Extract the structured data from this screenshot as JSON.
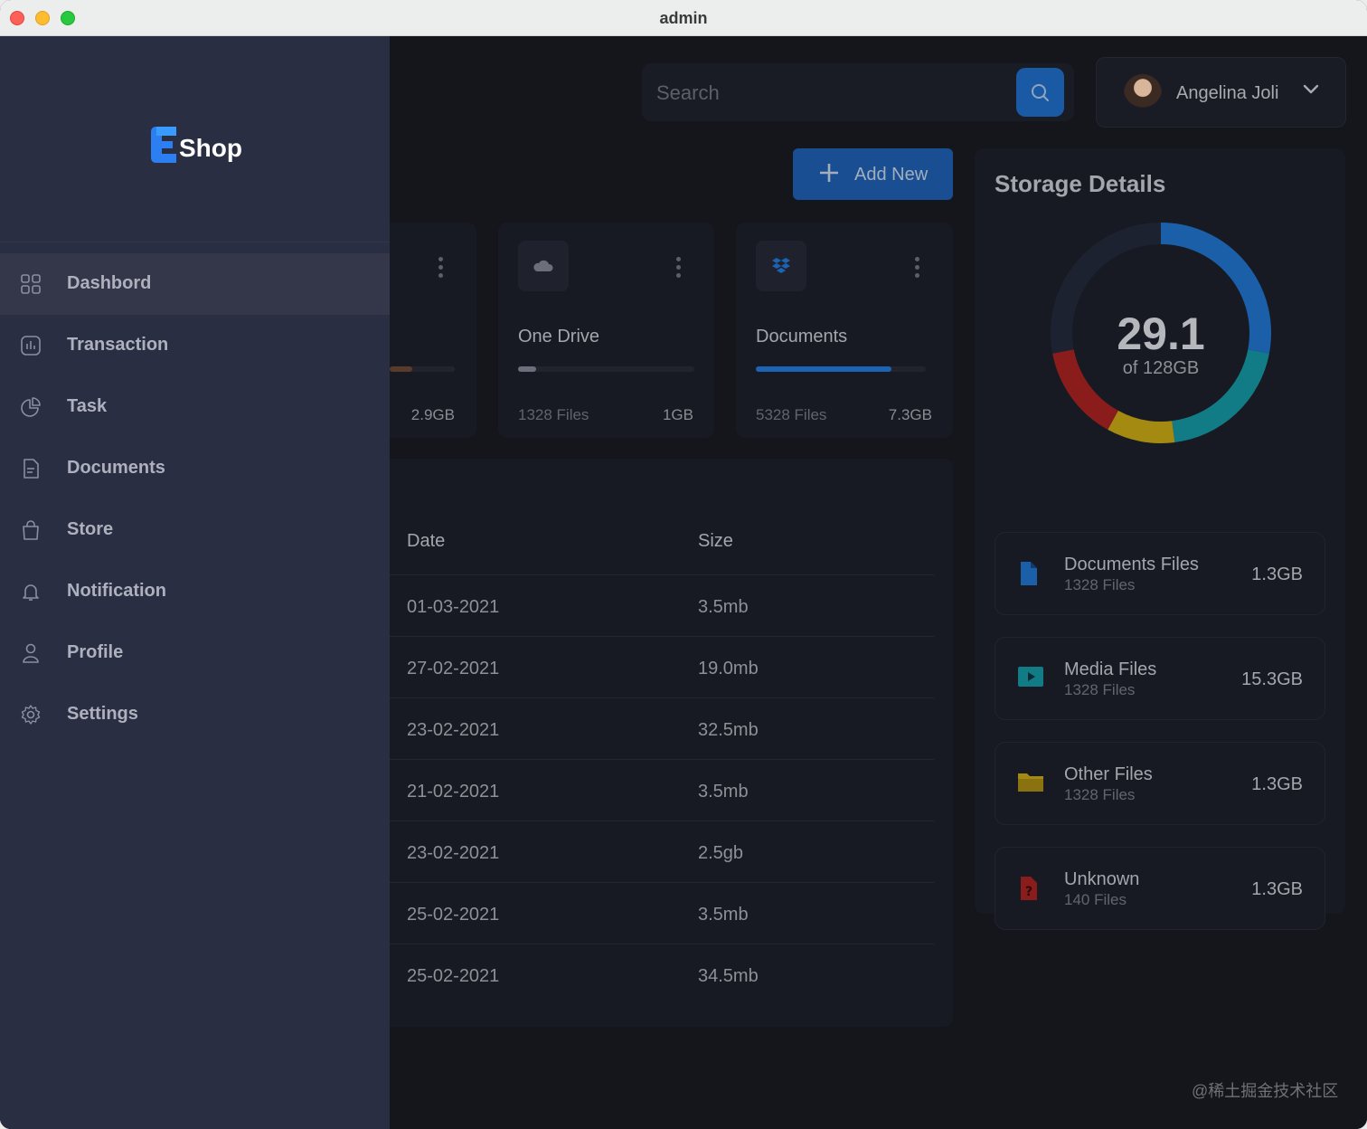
{
  "window": {
    "title": "admin"
  },
  "search": {
    "placeholder": "Search"
  },
  "profile": {
    "name": "Angelina Joli"
  },
  "add_button": {
    "label": "Add New"
  },
  "cards": [
    {
      "title": "",
      "files": "",
      "size": "2.9GB",
      "progress": 0.35
    },
    {
      "title": "One Drive",
      "files": "1328 Files",
      "size": "1GB",
      "progress": 0.1,
      "icon": "cloud-icon",
      "color": "#6b6f7a"
    },
    {
      "title": "Documents",
      "files": "5328 Files",
      "size": "7.3GB",
      "progress": 0.8,
      "icon": "dropbox-icon",
      "color": "#1d63b3"
    }
  ],
  "table": {
    "headers": {
      "date": "Date",
      "size": "Size"
    },
    "rows": [
      {
        "date": "01-03-2021",
        "size": "3.5mb"
      },
      {
        "date": "27-02-2021",
        "size": "19.0mb"
      },
      {
        "date": "23-02-2021",
        "size": "32.5mb"
      },
      {
        "date": "21-02-2021",
        "size": "3.5mb"
      },
      {
        "date": "23-02-2021",
        "size": "2.5gb"
      },
      {
        "date": "25-02-2021",
        "size": "3.5mb"
      },
      {
        "date": "25-02-2021",
        "size": "34.5mb"
      }
    ]
  },
  "storage": {
    "title": "Storage Details",
    "used": "29.1",
    "total": "of 128GB",
    "segments": [
      {
        "color": "#1a5fa8",
        "fraction": 0.28
      },
      {
        "color": "#127c86",
        "fraction": 0.2
      },
      {
        "color": "#a58a12",
        "fraction": 0.1
      },
      {
        "color": "#8b1c1c",
        "fraction": 0.14
      }
    ],
    "items": [
      {
        "name": "Documents Files",
        "count": "1328 Files",
        "size": "1.3GB",
        "icon": "document-file-icon",
        "color": "#1a5fa8"
      },
      {
        "name": "Media Files",
        "count": "1328 Files",
        "size": "15.3GB",
        "icon": "media-play-icon",
        "color": "#127c86"
      },
      {
        "name": "Other Files",
        "count": "1328 Files",
        "size": "1.3GB",
        "icon": "folder-icon",
        "color": "#a58a12"
      },
      {
        "name": "Unknown",
        "count": "140 Files",
        "size": "1.3GB",
        "icon": "unknown-file-icon",
        "color": "#8b1c1c"
      }
    ]
  },
  "sidebar": {
    "logo_text": "Shop",
    "items": [
      {
        "label": "Dashbord",
        "icon": "dashboard-grid-icon",
        "active": true
      },
      {
        "label": "Transaction",
        "icon": "chart-icon"
      },
      {
        "label": "Task",
        "icon": "pie-icon"
      },
      {
        "label": "Documents",
        "icon": "document-icon"
      },
      {
        "label": "Store",
        "icon": "bag-icon"
      },
      {
        "label": "Notification",
        "icon": "bell-icon"
      },
      {
        "label": "Profile",
        "icon": "user-icon"
      },
      {
        "label": "Settings",
        "icon": "gear-icon"
      }
    ]
  },
  "watermark": "@稀土掘金技术社区"
}
